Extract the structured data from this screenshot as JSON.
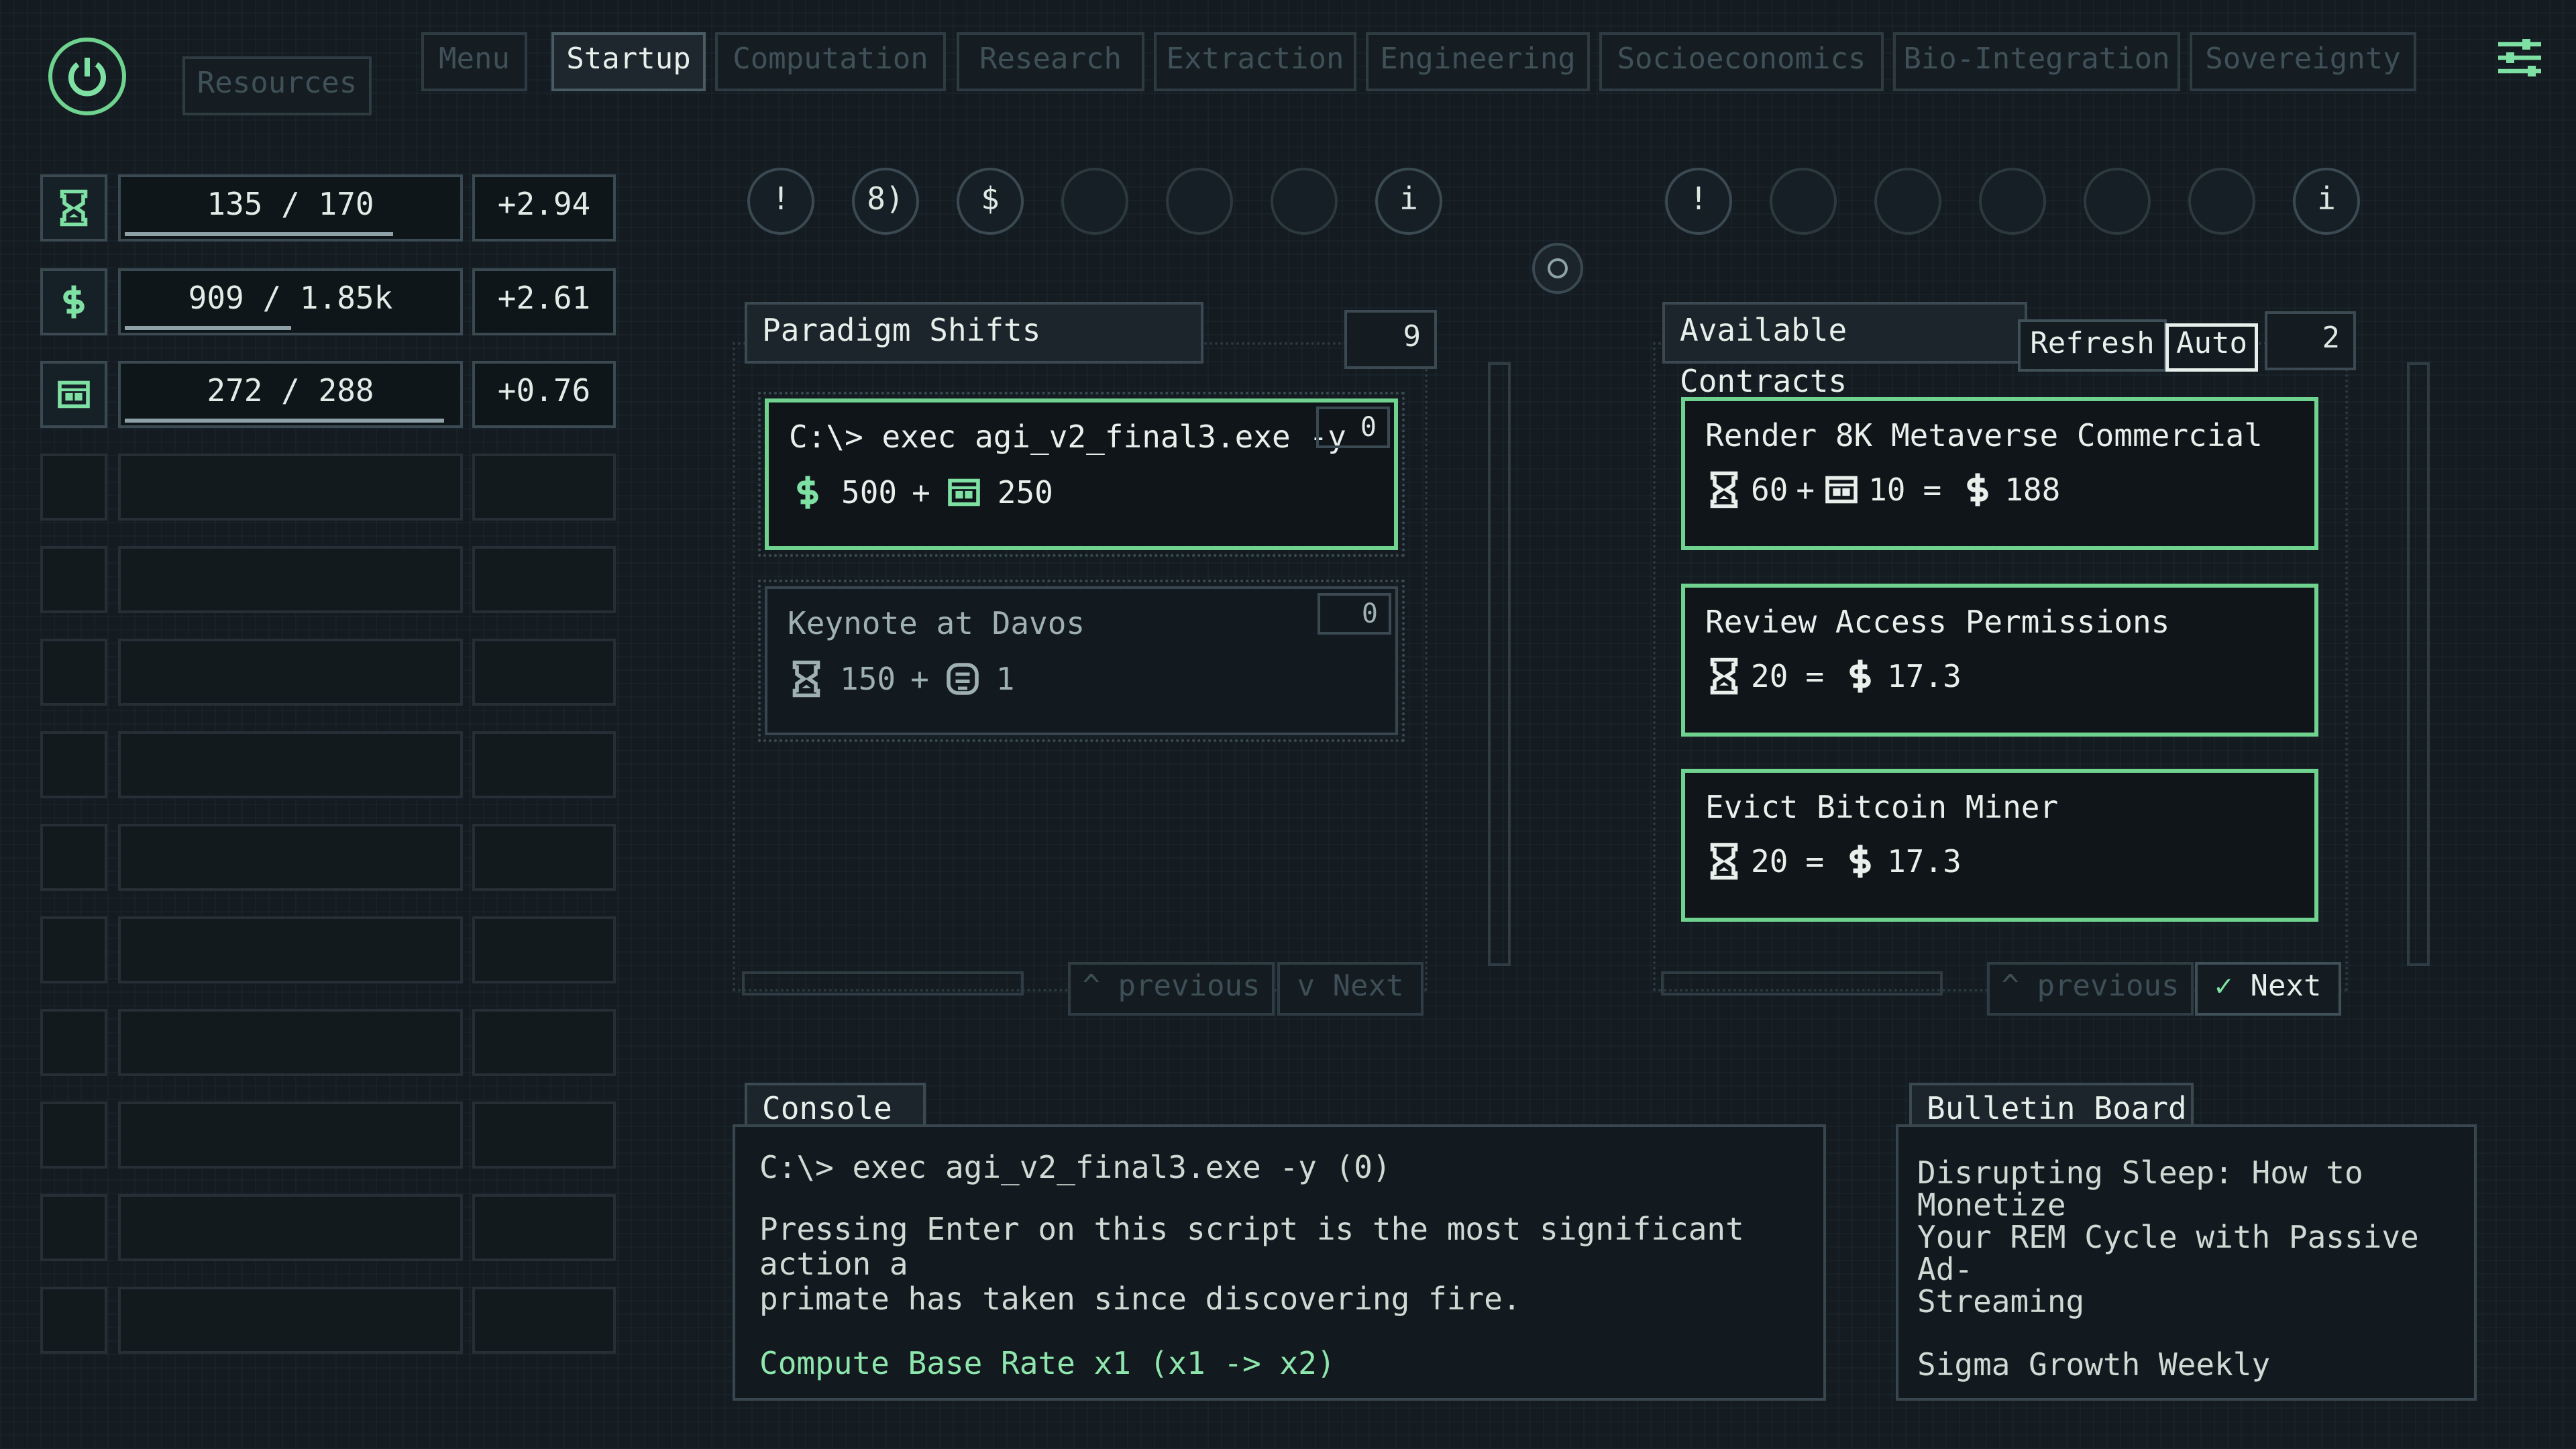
{
  "nav": {
    "tabs": [
      {
        "label": "Resources"
      },
      {
        "label": "Menu"
      },
      {
        "label": "Startup"
      },
      {
        "label": "Computation"
      },
      {
        "label": "Research"
      },
      {
        "label": "Extraction"
      },
      {
        "label": "Engineering"
      },
      {
        "label": "Socioeconomics"
      },
      {
        "label": "Bio-Integration"
      },
      {
        "label": "Sovereignty"
      }
    ],
    "active": "Startup"
  },
  "resources": [
    {
      "icon": "hourglass-icon",
      "value": "135 / 170",
      "rate": "+2.94",
      "fill": 0.79
    },
    {
      "icon": "dollar-icon",
      "value": "909 / 1.85k",
      "rate": "+2.61",
      "fill": 0.49
    },
    {
      "icon": "chip-icon",
      "value": "272 / 288",
      "rate": "+0.76",
      "fill": 0.94
    }
  ],
  "nodes_left": [
    "!",
    "8)",
    "$",
    "",
    "",
    "",
    "i"
  ],
  "nodes_right": [
    "!",
    "",
    "",
    "",
    "",
    "",
    "i"
  ],
  "paradigm": {
    "title": "Paradigm Shifts",
    "count": "9",
    "cards": [
      {
        "title": "C:\\> exec agi_v2_final3.exe -y",
        "badge": "0",
        "cost1": "500",
        "op": "+",
        "cost2": "250"
      },
      {
        "title": "Keynote at Davos",
        "badge": "0",
        "cost1": "150",
        "op": "+",
        "cost2": "1"
      }
    ],
    "prev": "previous",
    "next": "Next"
  },
  "contracts": {
    "title": "Available Contracts",
    "refresh": "Refresh",
    "auto": "Auto",
    "count": "2",
    "cards": [
      {
        "title": "Render 8K Metaverse Commercial",
        "time": "60",
        "plus": "+",
        "chip": "10",
        "eq": "=",
        "reward": "188"
      },
      {
        "title": "Review Access Permissions",
        "time": "20",
        "eq": "=",
        "reward": "17.3"
      },
      {
        "title": "Evict Bitcoin Miner",
        "time": "20",
        "eq": "=",
        "reward": "17.3"
      }
    ],
    "prev": "previous",
    "next": "Next"
  },
  "console": {
    "title": "Console",
    "line1": "C:\\> exec agi_v2_final3.exe -y (0)",
    "line2": "Pressing Enter on this script is the most significant action a",
    "line3": "primate has taken since discovering fire.",
    "line4": "Compute Base Rate x1 (x1 -> x2)"
  },
  "bulletin": {
    "title": "Bulletin Board",
    "line1": "Disrupting Sleep: How to Monetize",
    "line2": "Your REM Cycle with Passive Ad-",
    "line3": "Streaming",
    "line4": "Sigma Growth Weekly"
  },
  "colors": {
    "accent": "#7fe0a3",
    "bg": "#141c22",
    "border": "#3b4a52"
  }
}
